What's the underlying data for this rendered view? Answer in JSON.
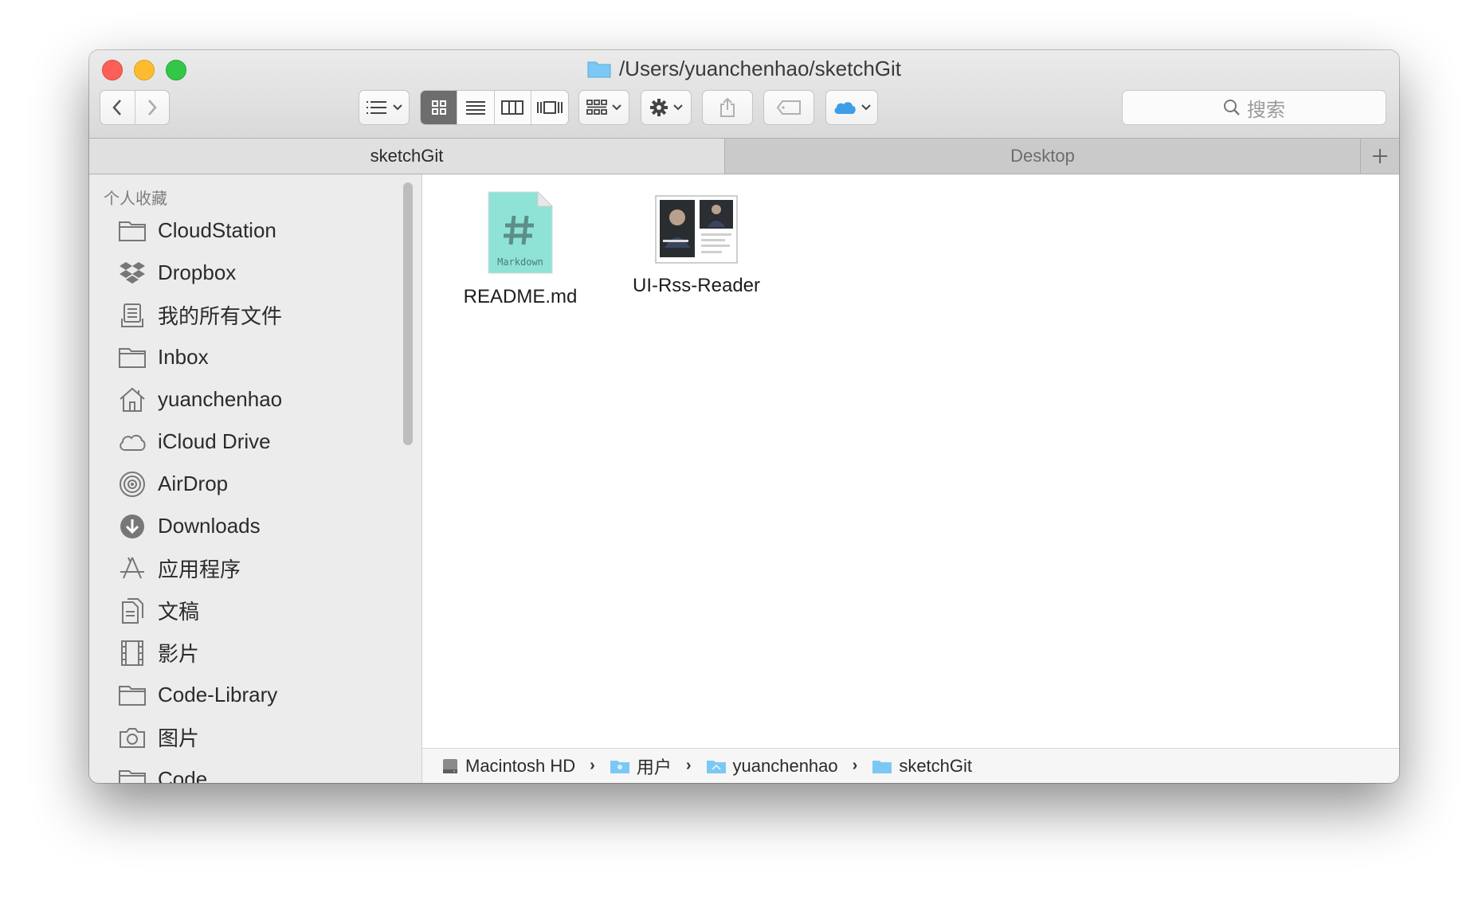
{
  "window": {
    "title": "/Users/yuanchenhao/sketchGit"
  },
  "toolbar": {
    "search_placeholder": "搜索"
  },
  "tabs": [
    {
      "label": "sketchGit",
      "active": true
    },
    {
      "label": "Desktop",
      "active": false
    }
  ],
  "sidebar": {
    "header": "个人收藏",
    "items": [
      {
        "label": "CloudStation",
        "icon": "folder-icon"
      },
      {
        "label": "Dropbox",
        "icon": "dropbox-icon"
      },
      {
        "label": "我的所有文件",
        "icon": "all-files-icon"
      },
      {
        "label": "Inbox",
        "icon": "folder-icon"
      },
      {
        "label": "yuanchenhao",
        "icon": "home-icon"
      },
      {
        "label": "iCloud Drive",
        "icon": "cloud-icon"
      },
      {
        "label": "AirDrop",
        "icon": "airdrop-icon"
      },
      {
        "label": "Downloads",
        "icon": "downloads-icon"
      },
      {
        "label": "应用程序",
        "icon": "applications-icon"
      },
      {
        "label": "文稿",
        "icon": "documents-icon"
      },
      {
        "label": "影片",
        "icon": "movies-icon"
      },
      {
        "label": "Code-Library",
        "icon": "folder-icon"
      },
      {
        "label": "图片",
        "icon": "camera-icon"
      },
      {
        "label": "Code",
        "icon": "folder-icon"
      }
    ]
  },
  "files": [
    {
      "name": "README.md",
      "icon_text": "Markdown"
    },
    {
      "name": "UI-Rss-Reader"
    }
  ],
  "pathbar": {
    "crumbs": [
      "Macintosh HD",
      "用户",
      "yuanchenhao",
      "sketchGit"
    ]
  },
  "colors": {
    "accent_folder": "#7cc8f4",
    "markdown_icon": "#8fe3d6",
    "close": "#fc5f57",
    "minimize": "#fdbc2f",
    "maximize": "#33c748"
  }
}
